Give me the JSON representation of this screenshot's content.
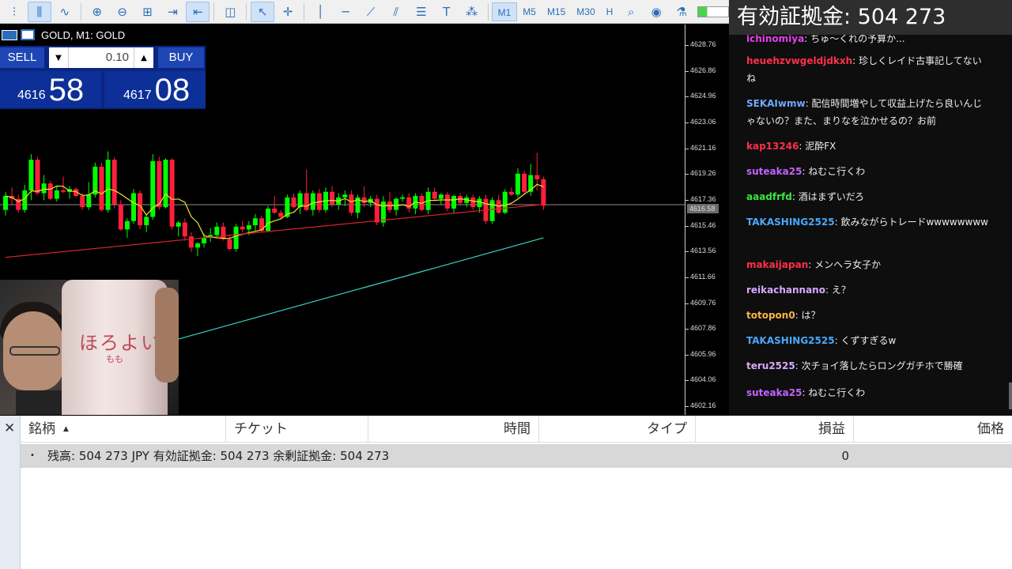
{
  "toolbar": {
    "timeframes": [
      "M1",
      "M5",
      "M15",
      "M30",
      "H"
    ],
    "active_timeframe": "M1"
  },
  "chart": {
    "title": "GOLD, M1:  GOLD",
    "sell_label": "SELL",
    "buy_label": "BUY",
    "lot": "0.10",
    "bid_prefix": "4616",
    "bid_big": "58",
    "ask_prefix": "4617",
    "ask_big": "08",
    "current_price": "4616.58",
    "price_ticks": [
      "4628.76",
      "4626.86",
      "4624.96",
      "4623.06",
      "4621.16",
      "4619.26",
      "4617.36",
      "4615.46",
      "4613.56",
      "4611.66",
      "4609.76",
      "4607.86",
      "4605.96",
      "4604.06",
      "4602.16"
    ],
    "colors": {
      "up": "#00ff00",
      "down": "#ff1f3d",
      "ma_fast": "#e8e82a",
      "ma_mid": "#d8242d",
      "ma_slow": "#37d3c3",
      "current_line": "#8c8c8c"
    }
  },
  "chart_data": {
    "type": "candlestick",
    "ylim": [
      4601.5,
      4629.5
    ],
    "candles": [
      [
        4616.2,
        4617.5,
        4615.8,
        4617.2
      ],
      [
        4617.2,
        4617.8,
        4616.6,
        4617.0
      ],
      [
        4617.0,
        4617.3,
        4616.0,
        4616.2
      ],
      [
        4616.2,
        4618.0,
        4616.0,
        4617.6
      ],
      [
        4617.6,
        4620.2,
        4616.9,
        4619.8
      ],
      [
        4619.8,
        4620.0,
        4617.3,
        4617.4
      ],
      [
        4617.4,
        4618.7,
        4616.9,
        4618.1
      ],
      [
        4618.1,
        4618.3,
        4616.9,
        4617.0
      ],
      [
        4617.0,
        4617.9,
        4616.8,
        4617.6
      ],
      [
        4617.6,
        4618.6,
        4617.4,
        4617.5
      ],
      [
        4617.5,
        4617.9,
        4617.0,
        4617.7
      ],
      [
        4617.7,
        4617.8,
        4617.1,
        4617.2
      ],
      [
        4617.2,
        4617.4,
        4616.2,
        4616.4
      ],
      [
        4616.4,
        4618.2,
        4616.2,
        4617.3
      ],
      [
        4617.3,
        4619.6,
        4617.1,
        4619.3
      ],
      [
        4619.3,
        4619.6,
        4616.1,
        4616.2
      ],
      [
        4616.2,
        4620.4,
        4616.0,
        4619.8
      ],
      [
        4619.8,
        4620.0,
        4616.3,
        4616.6
      ],
      [
        4616.6,
        4616.9,
        4614.7,
        4614.8
      ],
      [
        4614.8,
        4615.6,
        4614.2,
        4615.4
      ],
      [
        4615.4,
        4617.7,
        4615.2,
        4617.4
      ],
      [
        4617.4,
        4617.6,
        4614.8,
        4615.1
      ],
      [
        4615.1,
        4615.9,
        4614.6,
        4615.7
      ],
      [
        4615.7,
        4620.2,
        4615.5,
        4619.7
      ],
      [
        4619.7,
        4620.0,
        4616.2,
        4616.4
      ],
      [
        4616.4,
        4619.9,
        4616.3,
        4619.8
      ],
      [
        4619.8,
        4619.9,
        4614.8,
        4615.0
      ],
      [
        4615.0,
        4615.4,
        4614.3,
        4615.3
      ],
      [
        4615.3,
        4615.6,
        4614.0,
        4614.3
      ],
      [
        4614.3,
        4614.6,
        4613.2,
        4613.5
      ],
      [
        4613.5,
        4613.9,
        4612.9,
        4613.8
      ],
      [
        4613.8,
        4614.5,
        4613.5,
        4614.2
      ],
      [
        4614.2,
        4614.9,
        4613.9,
        4614.4
      ],
      [
        4614.4,
        4615.3,
        4614.2,
        4615.0
      ],
      [
        4615.0,
        4615.3,
        4614.0,
        4614.1
      ],
      [
        4614.1,
        4614.4,
        4613.3,
        4613.4
      ],
      [
        4613.4,
        4615.2,
        4613.2,
        4615.0
      ],
      [
        4615.0,
        4615.4,
        4614.6,
        4614.8
      ],
      [
        4614.8,
        4615.4,
        4614.4,
        4615.1
      ],
      [
        4615.1,
        4615.9,
        4614.7,
        4615.6
      ],
      [
        4615.6,
        4615.8,
        4614.6,
        4614.7
      ],
      [
        4614.7,
        4616.5,
        4614.6,
        4616.3
      ],
      [
        4616.3,
        4617.2,
        4615.9,
        4616.0
      ],
      [
        4616.0,
        4616.2,
        4615.5,
        4615.7
      ],
      [
        4615.7,
        4617.3,
        4615.6,
        4617.1
      ],
      [
        4617.1,
        4617.4,
        4616.3,
        4616.4
      ],
      [
        4616.4,
        4617.6,
        4615.9,
        4617.4
      ],
      [
        4617.4,
        4619.1,
        4616.1,
        4616.2
      ],
      [
        4616.2,
        4617.6,
        4615.8,
        4617.4
      ],
      [
        4617.4,
        4617.7,
        4616.0,
        4616.2
      ],
      [
        4616.2,
        4617.8,
        4616.0,
        4617.5
      ],
      [
        4617.5,
        4617.9,
        4616.4,
        4616.6
      ],
      [
        4616.6,
        4617.4,
        4616.2,
        4617.1
      ],
      [
        4617.1,
        4617.6,
        4616.5,
        4617.3
      ],
      [
        4617.3,
        4617.6,
        4615.8,
        4616.0
      ],
      [
        4616.0,
        4617.3,
        4615.6,
        4617.1
      ],
      [
        4617.1,
        4617.9,
        4616.4,
        4616.7
      ],
      [
        4616.7,
        4617.2,
        4616.4,
        4617.0
      ],
      [
        4617.0,
        4617.3,
        4615.1,
        4615.3
      ],
      [
        4615.3,
        4617.2,
        4615.0,
        4616.8
      ],
      [
        4616.8,
        4617.5,
        4616.0,
        4616.2
      ],
      [
        4616.2,
        4617.1,
        4615.8,
        4617.0
      ],
      [
        4617.0,
        4617.3,
        4616.8,
        4617.1
      ],
      [
        4617.1,
        4617.4,
        4616.0,
        4616.3
      ],
      [
        4616.3,
        4617.4,
        4615.9,
        4617.2
      ],
      [
        4617.2,
        4617.4,
        4616.1,
        4616.2
      ],
      [
        4616.2,
        4617.8,
        4615.9,
        4617.5
      ],
      [
        4617.5,
        4617.8,
        4616.9,
        4617.0
      ],
      [
        4617.0,
        4617.4,
        4616.6,
        4617.3
      ],
      [
        4617.3,
        4617.5,
        4616.1,
        4616.3
      ],
      [
        4616.3,
        4617.3,
        4616.0,
        4617.2
      ],
      [
        4617.2,
        4617.4,
        4616.6,
        4616.7
      ],
      [
        4616.7,
        4617.3,
        4616.4,
        4617.1
      ],
      [
        4617.1,
        4617.3,
        4616.2,
        4616.4
      ],
      [
        4616.4,
        4617.2,
        4616.0,
        4617.0
      ],
      [
        4617.0,
        4617.3,
        4615.2,
        4615.4
      ],
      [
        4615.4,
        4617.1,
        4615.2,
        4616.9
      ],
      [
        4616.9,
        4617.3,
        4615.9,
        4616.0
      ],
      [
        4616.0,
        4617.7,
        4615.9,
        4617.5
      ],
      [
        4617.5,
        4617.8,
        4617.2,
        4617.3
      ],
      [
        4617.3,
        4619.2,
        4617.1,
        4618.8
      ],
      [
        4618.8,
        4619.0,
        4617.3,
        4617.5
      ],
      [
        4617.5,
        4619.5,
        4617.2,
        4618.7
      ],
      [
        4618.7,
        4620.3,
        4617.6,
        4618.4
      ],
      [
        4618.4,
        4618.6,
        4616.2,
        4616.5
      ]
    ]
  },
  "balance_overlay": "有効証拠金: 504 273",
  "chat": [
    {
      "name": "ichinomiya",
      "text": "ちゅ〜くれの予算か...",
      "color": "#e73ef0"
    },
    {
      "name": "heuehzvwgeldjdkxh",
      "text": "珍しくレイド古事記してないね",
      "color": "#ff2f49"
    },
    {
      "name": "SEKAIwmw",
      "text": "配信時間増やして収益上げたら良いんじゃないの？また、まりなを泣かせるの？お前",
      "color": "#6fa8ff"
    },
    {
      "name": "kap13246",
      "text": "泥酔FX",
      "color": "#ff2f49"
    },
    {
      "name": "suteaka25",
      "text": "ねむこ行くわ",
      "color": "#c463ff"
    },
    {
      "name": "aaadfrfd",
      "text": "酒はまずいだろ",
      "color": "#3ae83a"
    },
    {
      "name": "TAKASHING2525",
      "text": "飲みながらトレードwwwwwwww",
      "color": "#4aa8ff"
    },
    {
      "name": "makaijapan",
      "text": "メンヘラ女子か",
      "color": "#ff2f49"
    },
    {
      "name": "reikachannano",
      "text": "え？",
      "color": "#d9a8ff"
    },
    {
      "name": "totopon0",
      "text": "は？",
      "color": "#ffb347"
    },
    {
      "name": "TAKASHING2525",
      "text": "くずすぎるw",
      "color": "#4aa8ff"
    },
    {
      "name": "teru2525",
      "text": "次チョイ落したらロングガチホで勝確",
      "color": "#d9a8ff"
    },
    {
      "name": "suteaka25",
      "text": "ねむこ行くわ",
      "color": "#c463ff"
    }
  ],
  "terminal": {
    "columns": [
      "銘柄",
      "チケット",
      "時間",
      "タイプ",
      "損益",
      "価格"
    ],
    "summary": "残高: 504 273 JPY  有効証拠金: 504 273  余剰証拠金: 504 273",
    "profit": "0"
  },
  "webcam": {
    "can_text": "ほろよい",
    "can_sub": "もも"
  }
}
